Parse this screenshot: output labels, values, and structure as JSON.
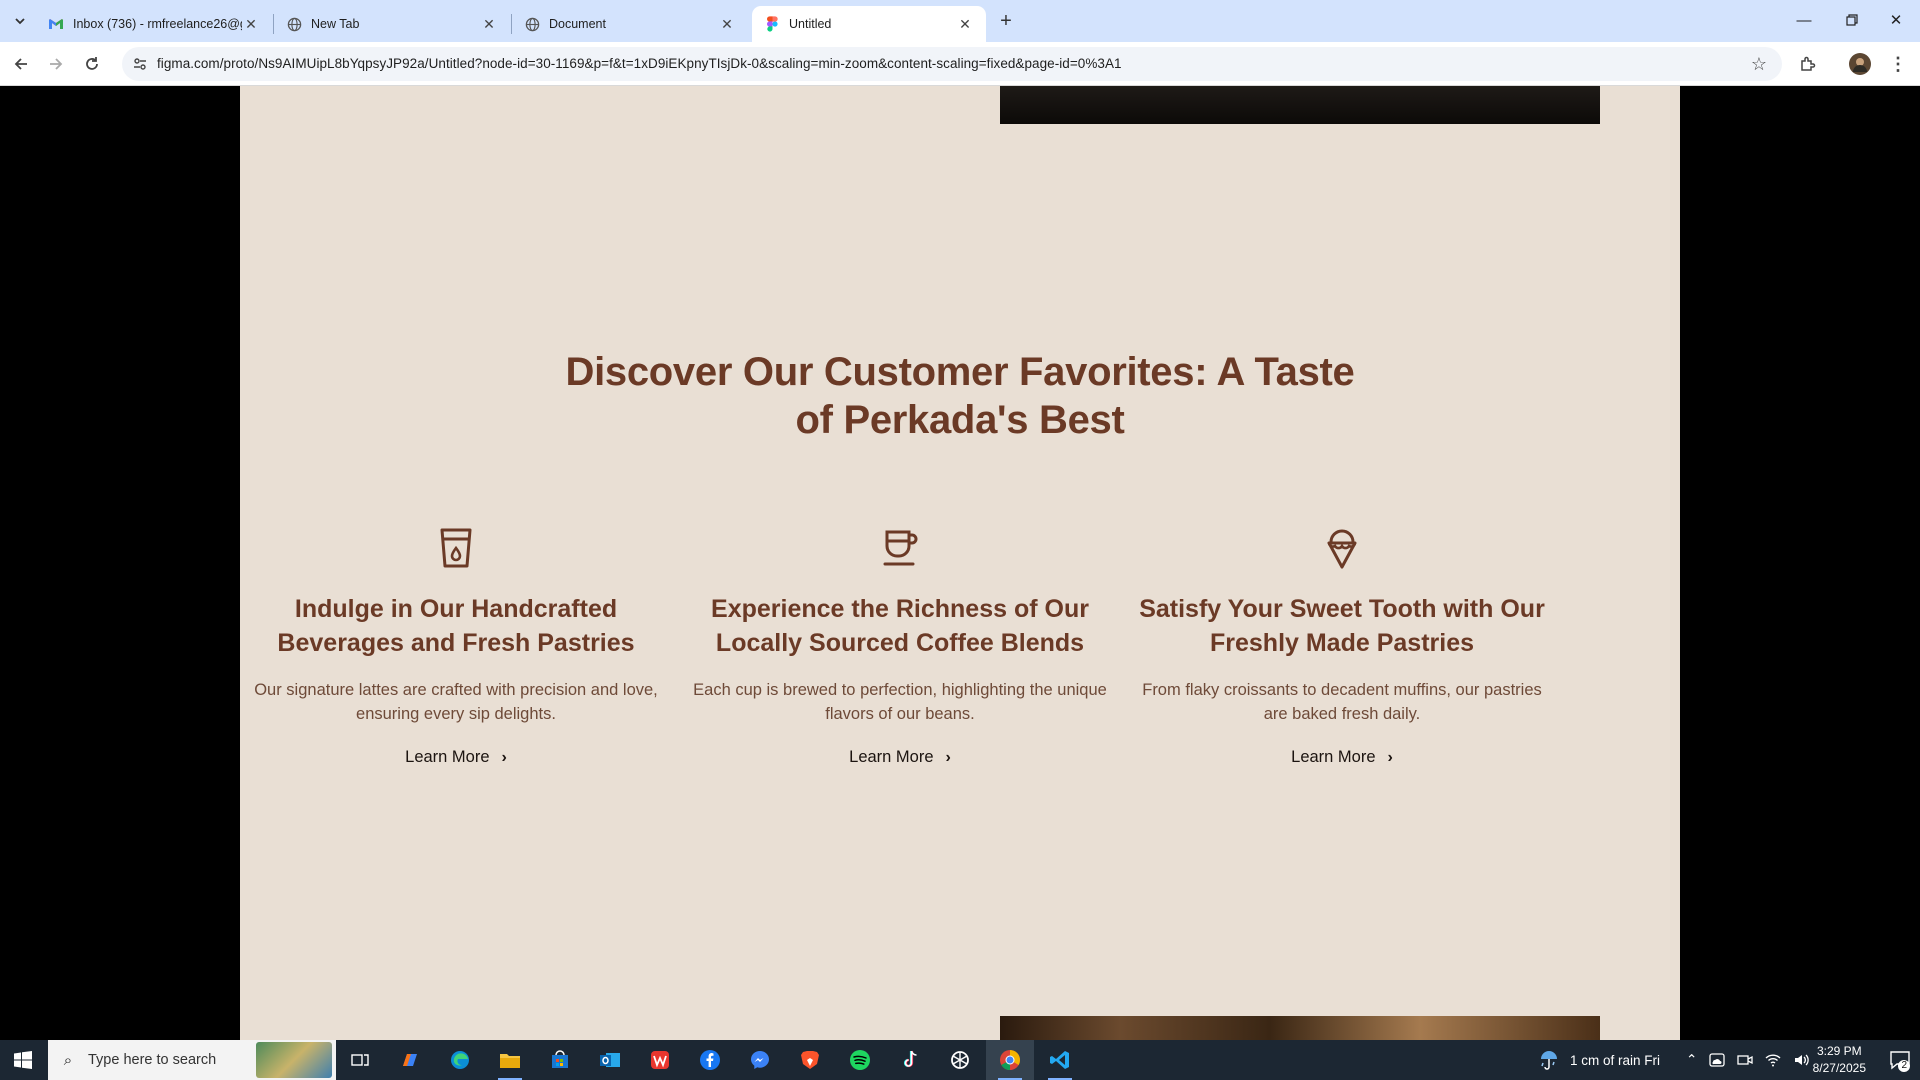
{
  "browser": {
    "tabs": [
      {
        "title": "Inbox (736) - rmfreelance26@g",
        "icon": "gmail-icon",
        "active": false
      },
      {
        "title": "New Tab",
        "icon": "globe-icon",
        "active": false
      },
      {
        "title": "Document",
        "icon": "globe-icon",
        "active": false
      },
      {
        "title": "Untitled",
        "icon": "figma-icon",
        "active": true
      }
    ],
    "url": "figma.com/proto/Ns9AIMUipL8bYqpsyJP92a/Untitled?node-id=30-1169&p=f&t=1xD9iEKpnyTIsjDk-0&scaling=min-zoom&content-scaling=fixed&page-id=0%3A1"
  },
  "page": {
    "heading": "Discover Our Customer Favorites: A Taste of Perkada's Best",
    "cards": [
      {
        "icon": "cup-icon",
        "title": "Indulge in Our Handcrafted Beverages and Fresh Pastries",
        "description": "Our signature lattes are crafted with precision and love, ensuring every sip delights.",
        "link": "Learn More"
      },
      {
        "icon": "coffee-cup-icon",
        "title": "Experience the Richness of Our Locally Sourced Coffee Blends",
        "description": "Each cup is brewed to perfection, highlighting the unique flavors of our beans.",
        "link": "Learn More"
      },
      {
        "icon": "ice-cream-icon",
        "title": "Satisfy Your Sweet Tooth with Our Freshly Made Pastries",
        "description": "From flaky croissants to decadent muffins, our pastries are baked fresh daily.",
        "link": "Learn More"
      }
    ],
    "colors": {
      "background": "#e9dfd4",
      "heading": "#6b3a26",
      "text": "#6e4a38"
    }
  },
  "taskbar": {
    "search_placeholder": "Type here to search",
    "weather": "1 cm of rain Fri",
    "time": "3:29 PM",
    "date": "8/27/2025",
    "notification_count": "2"
  }
}
